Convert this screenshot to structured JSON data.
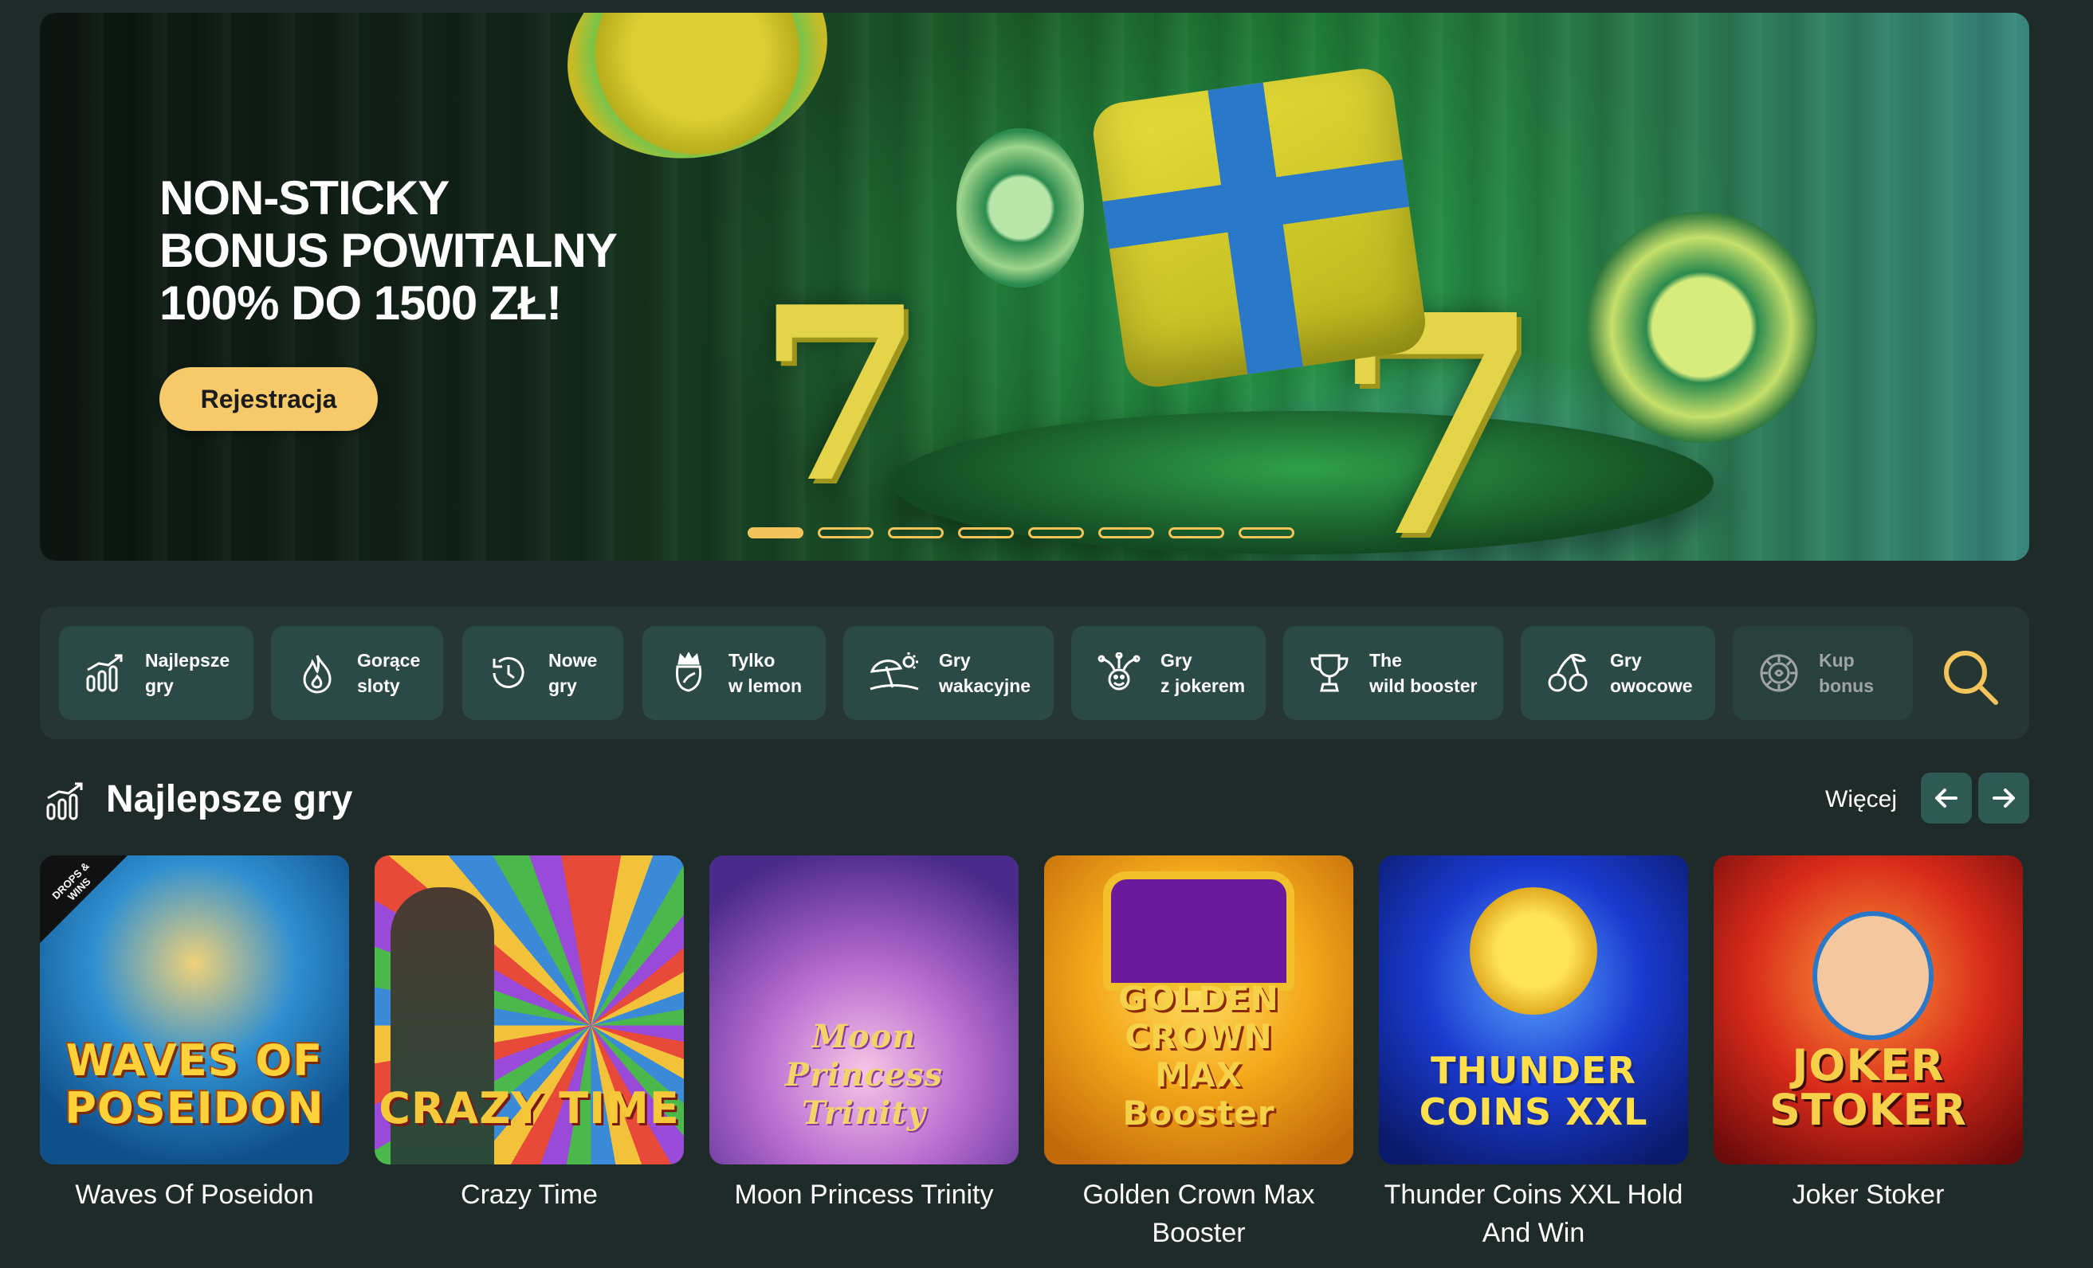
{
  "hero": {
    "title_lines": [
      "NON-STICKY",
      "BONUS POWITALNY",
      "100% DO 1500 ZŁ!"
    ],
    "cta_label": "Rejestracja",
    "slides_count": 8,
    "active_slide": 1,
    "colors": {
      "cta": "#f6c96b",
      "dots": "#f2c45b"
    }
  },
  "categories": [
    {
      "label": "Najlepsze\ngry",
      "icon": "chart-bars-icon"
    },
    {
      "label": "Gorące\nsloty",
      "icon": "flame-icon"
    },
    {
      "label": "Nowe\ngry",
      "icon": "clock-icon"
    },
    {
      "label": "Tylko\nw lemon",
      "icon": "crown-lemon-icon"
    },
    {
      "label": "Gry\nwakacyjne",
      "icon": "beach-sun-icon"
    },
    {
      "label": "Gry\nz jokerem",
      "icon": "jester-icon"
    },
    {
      "label": "The\nwild booster",
      "icon": "trophy-icon"
    },
    {
      "label": "Gry\nowocowe",
      "icon": "cherries-icon"
    },
    {
      "label": "Kup\nbonus",
      "icon": "chip-icon"
    }
  ],
  "search": {
    "icon": "search-icon",
    "color": "#f2c45b"
  },
  "section": {
    "title": "Najlepsze gry",
    "icon": "chart-bars-icon",
    "more_label": "Więcej"
  },
  "games": [
    {
      "name": "Waves Of Poseidon",
      "logo": "WAVES OF POSEIDON",
      "badge": "DROPS & WINS"
    },
    {
      "name": "Crazy Time",
      "logo": "CRAZY TIME"
    },
    {
      "name": "Moon Princess Trinity",
      "logo": "Moon Princess Trinity"
    },
    {
      "name": "Golden Crown Max Booster",
      "logo": "GOLDEN CROWN MAX Booster"
    },
    {
      "name": "Thunder Coins XXL Hold And Win",
      "logo": "THUNDER COINS XXL"
    },
    {
      "name": "Joker Stoker",
      "logo": "JOKER STOKER"
    }
  ]
}
